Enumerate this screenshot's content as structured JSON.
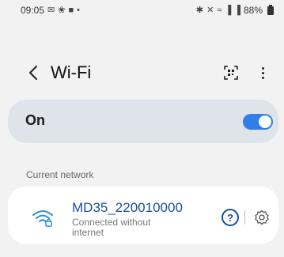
{
  "status_bar": {
    "time": "09:05",
    "left_icons": [
      "mail-icon",
      "handshake-icon",
      "video-icon",
      "dot-icon"
    ],
    "right_icons": [
      "bluetooth-icon",
      "mute-icon",
      "wifi-signal-icon",
      "volte-signal-icon",
      "volte-signal-icon"
    ],
    "battery": "88%"
  },
  "header": {
    "title": "Wi-Fi",
    "back_icon": "chevron-left-icon",
    "qr_icon": "qr-scan-icon",
    "more_icon": "more-vertical-icon"
  },
  "wifi_toggle": {
    "label": "On",
    "state": true,
    "accent_color": "#2f7fe6"
  },
  "current_network": {
    "section_label": "Current network",
    "name": "MD35_220010000",
    "status": "Connected without internet",
    "icon": "wifi-lock-icon",
    "help_icon": "help-icon",
    "settings_icon": "gear-icon",
    "name_color": "#1a4fa0"
  }
}
